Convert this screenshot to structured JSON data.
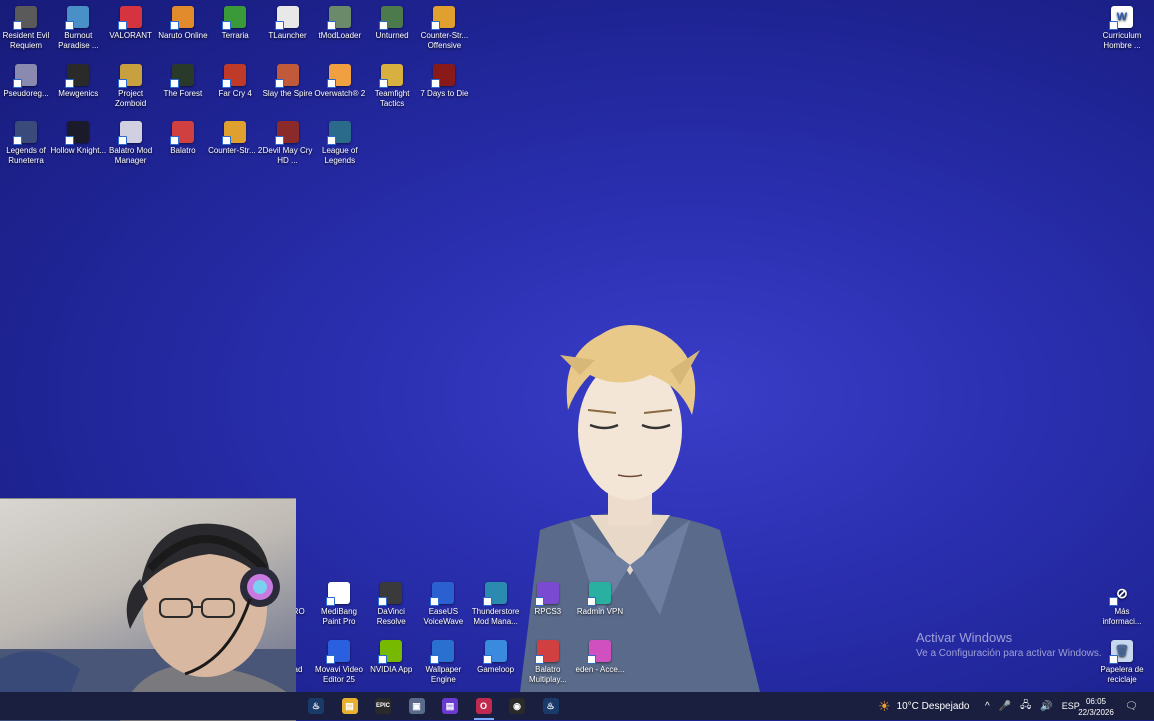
{
  "desktop_icons": [
    {
      "label": "Resident Evil Requiem",
      "icon": "resident-evil-icon",
      "color": "#5a5a5a"
    },
    {
      "label": "Burnout Paradise ...",
      "icon": "burnout-icon",
      "color": "#4a90c8"
    },
    {
      "label": "VALORANT",
      "icon": "valorant-icon",
      "color": "#d4333f"
    },
    {
      "label": "Naruto Online",
      "icon": "naruto-icon",
      "color": "#e28b2c"
    },
    {
      "label": "Terraria",
      "icon": "terraria-icon",
      "color": "#3a9a3a"
    },
    {
      "label": "TLauncher",
      "icon": "tlauncher-icon",
      "color": "#e8e8e8"
    },
    {
      "label": "tModLoader",
      "icon": "tmodloader-icon",
      "color": "#6a8a6a"
    },
    {
      "label": "Unturned",
      "icon": "unturned-icon",
      "color": "#4d7a4d"
    },
    {
      "label": "Counter-Str... Offensive",
      "icon": "csgo-icon",
      "color": "#e0a030"
    },
    {
      "label": "Pseudoreg...",
      "icon": "pseudoregalia-icon",
      "color": "#8a8ab0"
    },
    {
      "label": "Mewgenics",
      "icon": "mewgenics-icon",
      "color": "#2a2a2a"
    },
    {
      "label": "Project Zomboid",
      "icon": "project-zomboid-icon",
      "color": "#c8a040"
    },
    {
      "label": "The Forest",
      "icon": "the-forest-icon",
      "color": "#2a3a2a"
    },
    {
      "label": "Far Cry 4",
      "icon": "far-cry-4-icon",
      "color": "#c03a2a"
    },
    {
      "label": "Slay the Spire",
      "icon": "slay-the-spire-icon",
      "color": "#c05a3a"
    },
    {
      "label": "Overwatch® 2",
      "icon": "overwatch-icon",
      "color": "#f0a040"
    },
    {
      "label": "Teamfight Tactics",
      "icon": "teamfight-tactics-icon",
      "color": "#d8b040"
    },
    {
      "label": "7 Days to Die",
      "icon": "7-days-to-die-icon",
      "color": "#8a1a1a"
    },
    {
      "label": "Legends of Runeterra",
      "icon": "legends-of-runeterra-icon",
      "color": "#3a4a7a"
    },
    {
      "label": "Hollow Knight...",
      "icon": "hollow-knight-icon",
      "color": "#1a1a2a"
    },
    {
      "label": "Balatro Mod Manager",
      "icon": "balatro-mod-manager-icon",
      "color": "#d0d0e0"
    },
    {
      "label": "Balatro",
      "icon": "balatro-icon",
      "color": "#d04040"
    },
    {
      "label": "Counter-Str... 2",
      "icon": "cs2-icon",
      "color": "#e0a030"
    },
    {
      "label": "Devil May Cry HD ...",
      "icon": "devil-may-cry-icon",
      "color": "#8a2a2a"
    },
    {
      "label": "League of Legends",
      "icon": "league-of-legends-icon",
      "color": "#2a6a8a"
    }
  ],
  "right_icons": [
    {
      "label": "Curriculum Hombre ...",
      "icon": "word-document-icon",
      "color": "#ffffff"
    },
    {
      "label": "Más informaci...",
      "icon": "info-widget-icon",
      "color": "#3a3a5a"
    },
    {
      "label": "Papelera de reciclaje",
      "icon": "recycle-bin-icon",
      "color": "#c8d8f0"
    }
  ],
  "bottom_icons_row1": [
    {
      "label": "PRO",
      "icon": "partial-pro-icon",
      "color": "#2a2fb0"
    },
    {
      "label": "MediBang Paint Pro",
      "icon": "medibang-icon",
      "color": "#ffffff"
    },
    {
      "label": "DaVinci Resolve",
      "icon": "davinci-resolve-icon",
      "color": "#3a3a3a"
    },
    {
      "label": "EaseUS VoiceWave",
      "icon": "easeus-voicewave-icon",
      "color": "#2a60d0"
    },
    {
      "label": "Thunderstore Mod Mana...",
      "icon": "thunderstore-icon",
      "color": "#2a8ab0"
    },
    {
      "label": "RPCS3",
      "icon": "rpcs3-icon",
      "color": "#7a4ad0"
    },
    {
      "label": "Radmin VPN",
      "icon": "radmin-vpn-icon",
      "color": "#2ab0a0"
    }
  ],
  "bottom_icons_row2": [
    {
      "label": "vad",
      "icon": "partial-vad-icon",
      "color": "#d03a3a"
    },
    {
      "label": "Movavi Video Editor 25",
      "icon": "movavi-icon",
      "color": "#2a60e0"
    },
    {
      "label": "NVIDIA App",
      "icon": "nvidia-icon",
      "color": "#76b900"
    },
    {
      "label": "Wallpaper Engine",
      "icon": "wallpaper-engine-icon",
      "color": "#2a70d0"
    },
    {
      "label": "Gameloop",
      "icon": "gameloop-icon",
      "color": "#3a8ae0"
    },
    {
      "label": "Balatro Multiplay...",
      "icon": "balatro-multiplayer-icon",
      "color": "#d04040"
    },
    {
      "label": "eden - Acce...",
      "icon": "eden-icon",
      "color": "#d050c0"
    }
  ],
  "watermark": {
    "title": "Activar Windows",
    "subtitle": "Ve a Configuración para activar Windows."
  },
  "taskbar": {
    "apps": [
      {
        "icon": "steam-icon",
        "color": "#1a3a6a",
        "glyph": "♨"
      },
      {
        "icon": "file-explorer-icon",
        "color": "#e8b030",
        "glyph": "▤"
      },
      {
        "icon": "epic-games-icon",
        "color": "#2a2a2a",
        "glyph": "EPIC"
      },
      {
        "icon": "window-app-icon",
        "color": "#5a6a8a",
        "glyph": "▣"
      },
      {
        "icon": "app-purple-icon",
        "color": "#6a3ad0",
        "glyph": "▤"
      },
      {
        "icon": "opera-gx-icon",
        "color": "#c02a50",
        "glyph": "O"
      },
      {
        "icon": "obs-icon",
        "color": "#2a2a2a",
        "glyph": "◉"
      },
      {
        "icon": "steam-alt-icon",
        "color": "#1a3a6a",
        "glyph": "♨"
      }
    ],
    "weather": "10°C  Despejado",
    "language": "ESP",
    "time": "06:05",
    "date": "22/3/2026"
  }
}
